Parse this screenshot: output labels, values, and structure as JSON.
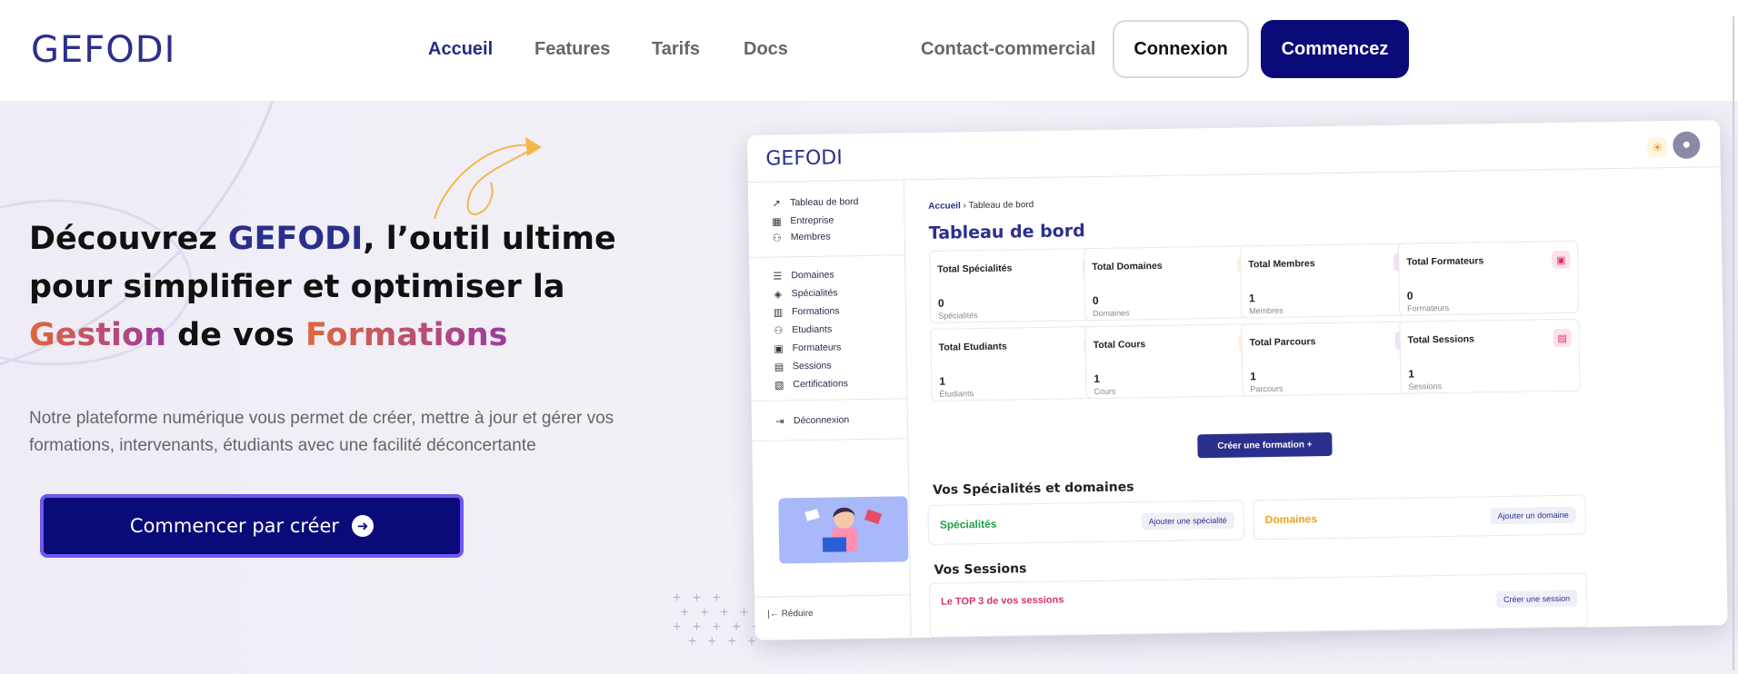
{
  "header": {
    "logo": "GEFODI",
    "nav": [
      "Accueil",
      "Features",
      "Tarifs",
      "Docs",
      "Contact-commercial"
    ],
    "login_label": "Connexion",
    "start_label": "Commencez"
  },
  "hero": {
    "headline": {
      "p1": "Découvrez ",
      "brand": "GEFODI",
      "p2": ", l’outil ultime pour simplifier et optimiser la ",
      "w1": "Gestion",
      "p3": " de vos ",
      "w2": "Formations"
    },
    "subtext": "Notre plateforme numérique vous permet de créer, mettre à jour et gérer vos formations, intervenants, étudiants avec une facilité déconcertante",
    "cta_label": "Commencer par créer"
  },
  "mockup": {
    "logo": "GEFODI",
    "sidebar": [
      "Tableau de bord",
      "Entreprise",
      "Membres",
      "Domaines",
      "Spécialités",
      "Formations",
      "Etudiants",
      "Formateurs",
      "Sessions",
      "Certifications",
      "Déconnexion"
    ],
    "reduce_label": "Réduire",
    "breadcrumb": {
      "home": "Accueil",
      "current": "Tableau de bord"
    },
    "title": "Tableau de bord",
    "cards": [
      {
        "title": "Total Spécialités",
        "value": "0",
        "sub": "Spécialités"
      },
      {
        "title": "Total Domaines",
        "value": "0",
        "sub": "Domaines"
      },
      {
        "title": "Total Membres",
        "value": "1",
        "sub": "Membres"
      },
      {
        "title": "Total Formateurs",
        "value": "0",
        "sub": "Formateurs"
      },
      {
        "title": "Total Etudiants",
        "value": "1",
        "sub": "Étudiants"
      },
      {
        "title": "Total Cours",
        "value": "1",
        "sub": "Cours"
      },
      {
        "title": "Total Parcours",
        "value": "1",
        "sub": "Parcours"
      },
      {
        "title": "Total Sessions",
        "value": "1",
        "sub": "Sessions"
      }
    ],
    "create_button": "Créer une formation +",
    "section1": "Vos Spécialités et domaines",
    "specialites": {
      "title": "Spécialités",
      "button": "Ajouter une spécialité"
    },
    "domaines": {
      "title": "Domaines",
      "button": "Ajouter un domaine"
    },
    "section2": "Vos Sessions",
    "sessions": {
      "title": "Le TOP 3 de vos sessions",
      "button": "Créer une session"
    }
  },
  "colors": {
    "brand": "#2b2f8c",
    "primary_button": "#0a0a78",
    "gradient_start": "#e0673a",
    "gradient_end": "#9b3aa0",
    "specialites": "#22a04a",
    "domaines": "#f0a020",
    "sessions": "#d6336c"
  },
  "icons": [
    "sun-icon",
    "user-avatar-icon",
    "arrow-right-circle-icon",
    "chart-icon",
    "building-icon",
    "users-icon",
    "layers-icon",
    "book-icon",
    "graduate-icon",
    "presentation-icon",
    "calendar-icon",
    "certificate-icon",
    "logout-icon",
    "collapse-icon"
  ]
}
